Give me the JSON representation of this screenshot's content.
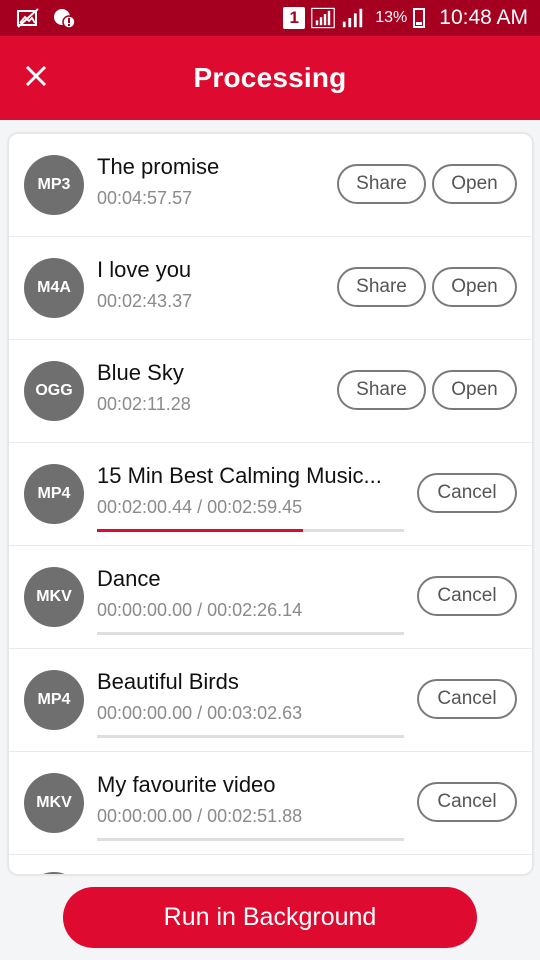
{
  "status_bar": {
    "sim_slot": "1",
    "battery_percent": "13%",
    "time": "10:48 AM",
    "icons": [
      "gallery-off-icon",
      "alert-icon",
      "sim-icon",
      "signal-icon",
      "signal-icon",
      "battery-icon"
    ]
  },
  "app_bar": {
    "title": "Processing",
    "close_icon": "close-icon",
    "color": "#de0a2f"
  },
  "items": [
    {
      "format": "MP3",
      "name": "The promise",
      "duration": "00:04:57.57",
      "status": "done",
      "share_label": "Share",
      "open_label": "Open"
    },
    {
      "format": "M4A",
      "name": "I love you",
      "duration": "00:02:43.37",
      "status": "done",
      "share_label": "Share",
      "open_label": "Open"
    },
    {
      "format": "OGG",
      "name": "Blue Sky",
      "duration": "00:02:11.28",
      "status": "done",
      "share_label": "Share",
      "open_label": "Open"
    },
    {
      "format": "MP4",
      "name": "15 Min Best Calming Music...",
      "progress_text": "00:02:00.44 / 00:02:59.45",
      "progress": 0.67,
      "status": "processing",
      "cancel_label": "Cancel"
    },
    {
      "format": "MKV",
      "name": "Dance",
      "progress_text": "00:00:00.00 / 00:02:26.14",
      "progress": 0,
      "status": "queued",
      "cancel_label": "Cancel"
    },
    {
      "format": "MP4",
      "name": "Beautiful Birds",
      "progress_text": "00:00:00.00 / 00:03:02.63",
      "progress": 0,
      "status": "queued",
      "cancel_label": "Cancel"
    },
    {
      "format": "MKV",
      "name": "My favourite video",
      "progress_text": "00:00:00.00 / 00:02:51.88",
      "progress": 0,
      "status": "queued",
      "cancel_label": "Cancel"
    }
  ],
  "run_background_label": "Run in Background"
}
